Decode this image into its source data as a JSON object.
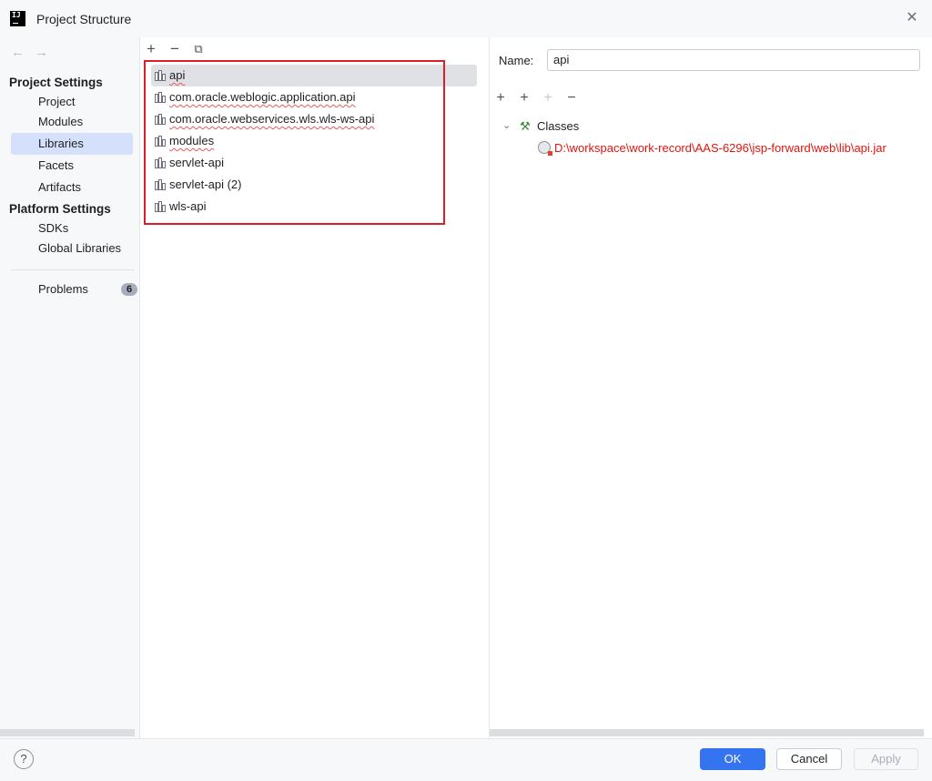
{
  "window": {
    "title": "Project Structure",
    "logo_text": "IJ"
  },
  "nav": {
    "back_icon": "←",
    "forward_icon": "→",
    "project_settings_header": "Project Settings",
    "project_items": [
      "Project",
      "Modules",
      "Libraries",
      "Facets",
      "Artifacts"
    ],
    "platform_settings_header": "Platform Settings",
    "platform_items": [
      "SDKs",
      "Global Libraries"
    ],
    "problems_label": "Problems",
    "problems_count": "6",
    "selected": "Libraries"
  },
  "libraries": {
    "toolbar": {
      "add": "+",
      "remove": "−",
      "copy": "⧉"
    },
    "items": [
      "api",
      "com.oracle.weblogic.application.api",
      "com.oracle.webservices.wls.wls-ws-api",
      "modules",
      "servlet-api",
      "servlet-api (2)",
      "wls-api"
    ],
    "selected": "api"
  },
  "details": {
    "name_label": "Name:",
    "name_value": "api",
    "toolbar": {
      "add": "+",
      "add_special": "+",
      "add_disabled": "+",
      "remove": "−"
    },
    "tree_expand_icon": "⌄",
    "classes_label": "Classes",
    "class_path": "D:\\workspace\\work-record\\AAS-6296\\jsp-forward\\web\\lib\\api.jar"
  },
  "footer": {
    "help_label": "?",
    "ok_label": "OK",
    "cancel_label": "Cancel",
    "apply_label": "Apply"
  },
  "colors": {
    "accent": "#3574f0",
    "error_text": "#e2140d",
    "highlight_box": "#db1e2c",
    "selection": "#d5e1fc"
  }
}
